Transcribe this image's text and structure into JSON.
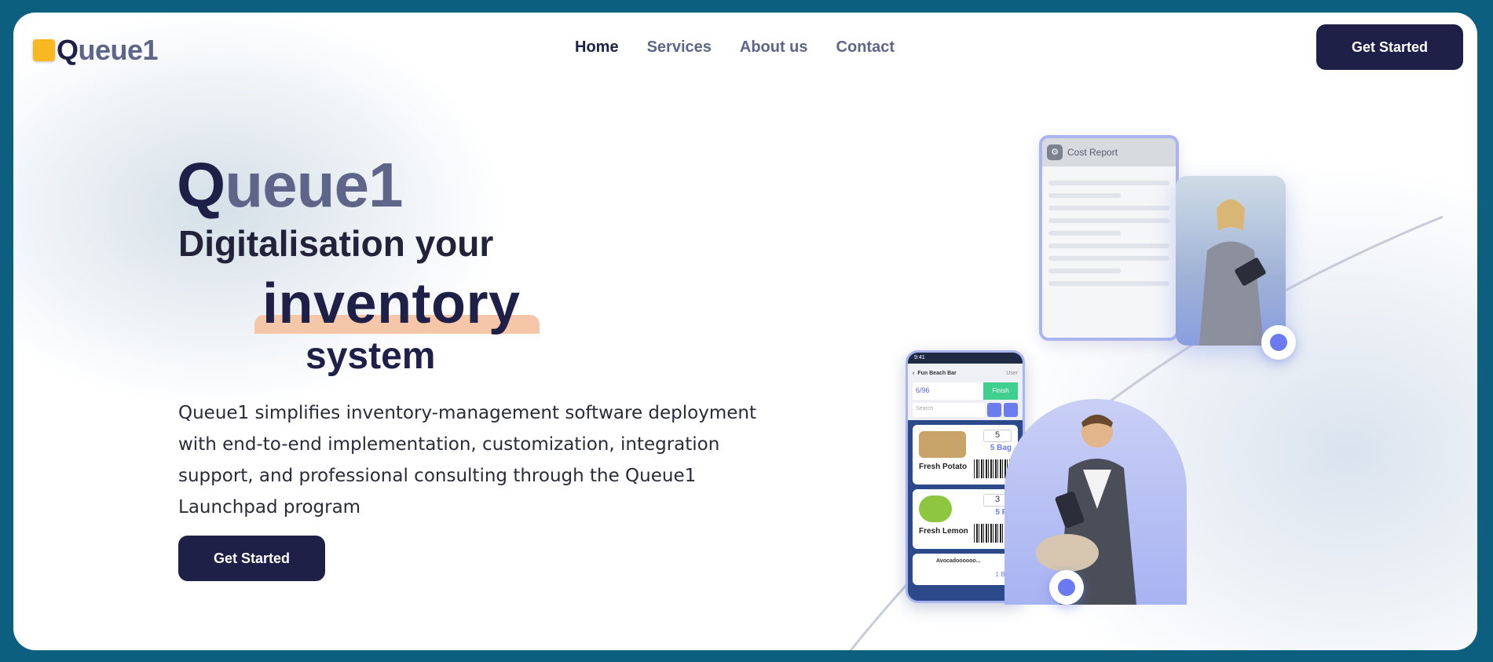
{
  "nav": {
    "logo_first": "Q",
    "logo_rest": "ueue1",
    "links": [
      "Home",
      "Services",
      "About us",
      "Contact"
    ],
    "active": "Home",
    "cta": "Get Started"
  },
  "hero": {
    "brand_first": "Q",
    "brand_rest": "ueue1",
    "line1": "Digitalisation your",
    "line2": "inventory",
    "line3": "system",
    "description": "Queue1 simplifies inventory-management software deployment with end-to-end implementation, customization, integration support, and professional consulting through the Queue1 Launchpad program",
    "cta": "Get Started"
  },
  "illustration": {
    "report_title": "Cost Report",
    "phone": {
      "time": "9:41",
      "location": "Fun Beach Bar",
      "user": "User",
      "count": "6/96",
      "finish": "Finish",
      "search_placeholder": "Search",
      "items": [
        {
          "name": "Fresh Potato",
          "qty": "5",
          "unit": "5 Bag"
        },
        {
          "name": "Fresh Lemon",
          "qty": "3",
          "unit": "5 Pc"
        },
        {
          "name": "Avocadoooooo...",
          "qty": "",
          "unit": "1 Box"
        }
      ]
    }
  },
  "colors": {
    "frame_bg": "#0d5f80",
    "primary": "#1e2048",
    "muted": "#5f6589",
    "highlight": "#f5c7a8",
    "logo_mark": "#f9b822",
    "accent": "#6b7af0"
  }
}
